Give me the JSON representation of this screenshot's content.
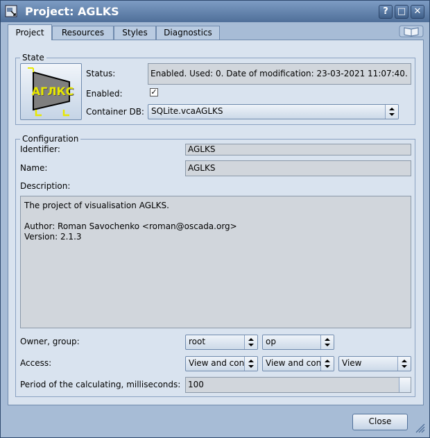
{
  "window": {
    "title": "Project: AGLKS"
  },
  "titlebar_buttons": {
    "help": "?",
    "maximize": "□",
    "close": "✕"
  },
  "tabs": [
    {
      "label": "Project",
      "active": true
    },
    {
      "label": "Resources",
      "active": false
    },
    {
      "label": "Styles",
      "active": false
    },
    {
      "label": "Diagnostics",
      "active": false
    }
  ],
  "state": {
    "group_title": "State",
    "logo_text": "АГЛКС",
    "status_label": "Status:",
    "status_value": "Enabled. Used: 0. Date of modification: 23-03-2021 11:07:40.",
    "enabled_label": "Enabled:",
    "enabled_checked": true,
    "enabled_mark": "✓",
    "container_db_label": "Container DB:",
    "container_db_value": "SQLite.vcaAGLKS"
  },
  "configuration": {
    "group_title": "Configuration",
    "identifier_label": "Identifier:",
    "identifier_value": "AGLKS",
    "name_label": "Name:",
    "name_value": "AGLKS",
    "description_label": "Description:",
    "description_value": "The project of visualisation AGLKS.\n\nAuthor: Roman Savochenko <roman@oscada.org>\nVersion: 2.1.3",
    "owner_group_label": "Owner, group:",
    "owner_value": "root",
    "group_value": "op",
    "access_label": "Access:",
    "access_owner": "View and control",
    "access_group": "View and control",
    "access_other": "View",
    "period_label": "Period of the calculating, milliseconds:",
    "period_value": "100"
  },
  "footer": {
    "close_label": "Close"
  },
  "colors": {
    "titlebar": "#4f6f99",
    "panel": "#d9e3ef",
    "logo_text": "#e8e800"
  }
}
